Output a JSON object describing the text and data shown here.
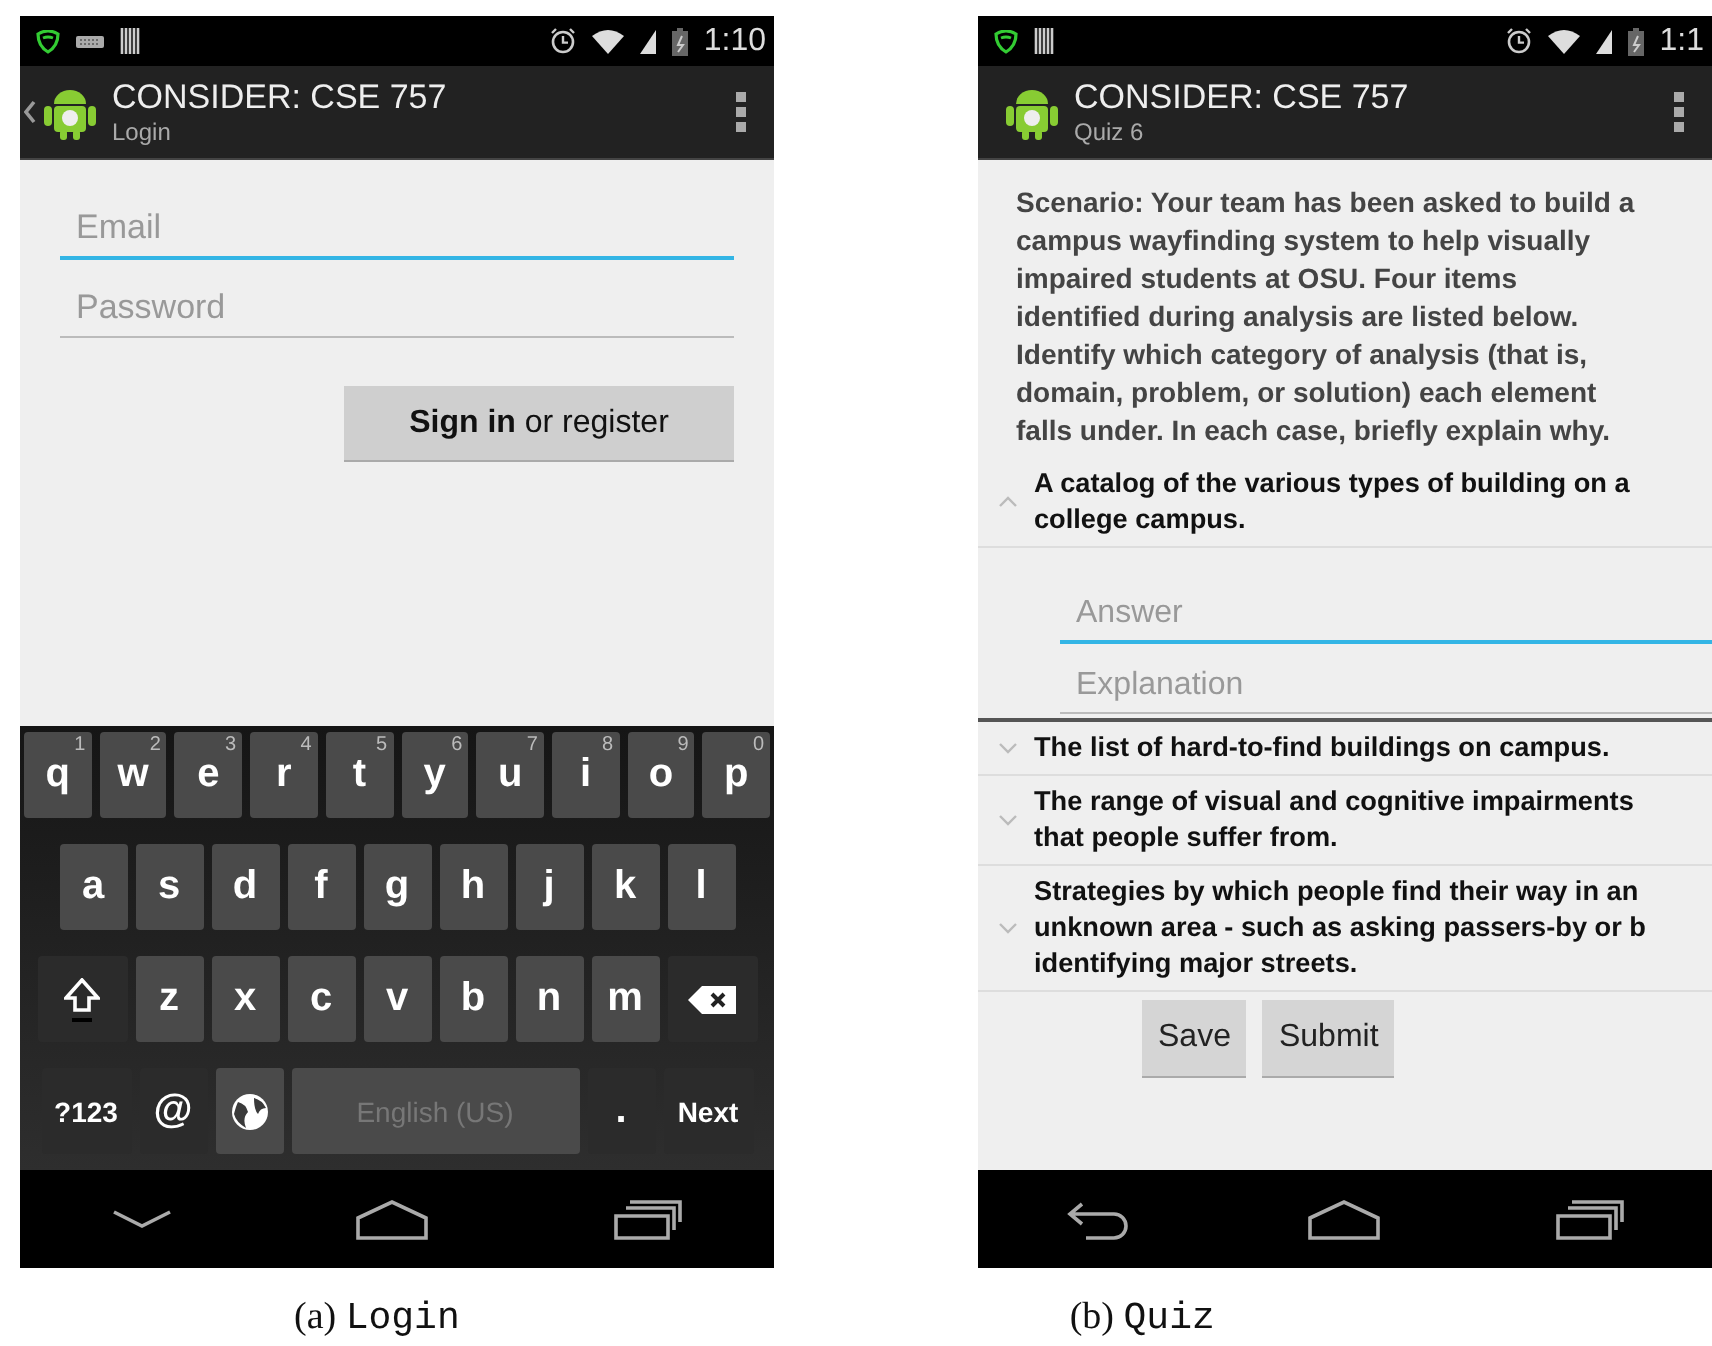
{
  "login": {
    "status_bar": {
      "time": "1:10",
      "keyboard_notice": true
    },
    "action_bar": {
      "title": "CONSIDER: CSE 757",
      "subtitle": "Login",
      "back": true
    },
    "fields": [
      {
        "placeholder": "Email",
        "focused": true
      },
      {
        "placeholder": "Password",
        "focused": false
      }
    ],
    "button": "**Sign in** or register",
    "keyboard": {
      "rows": [
        {
          "keys": [
            {
              "kind": "letter",
              "label": "q",
              "hint": "1"
            },
            {
              "kind": "letter",
              "label": "w",
              "hint": "2"
            },
            {
              "kind": "letter",
              "label": "e",
              "hint": "3"
            },
            {
              "kind": "letter",
              "label": "r",
              "hint": "4"
            },
            {
              "kind": "letter",
              "label": "t",
              "hint": "5"
            },
            {
              "kind": "letter",
              "label": "y",
              "hint": "6"
            },
            {
              "kind": "letter",
              "label": "u",
              "hint": "7"
            },
            {
              "kind": "letter",
              "label": "i",
              "hint": "8"
            },
            {
              "kind": "letter",
              "label": "o",
              "hint": "9"
            },
            {
              "kind": "letter",
              "label": "p",
              "hint": "0"
            }
          ]
        },
        {
          "keys": [
            {
              "kind": "letter",
              "label": "a"
            },
            {
              "kind": "letter",
              "label": "s"
            },
            {
              "kind": "letter",
              "label": "d"
            },
            {
              "kind": "letter",
              "label": "f"
            },
            {
              "kind": "letter",
              "label": "g"
            },
            {
              "kind": "letter",
              "label": "h"
            },
            {
              "kind": "letter",
              "label": "j"
            },
            {
              "kind": "letter",
              "label": "k"
            },
            {
              "kind": "letter",
              "label": "l"
            }
          ]
        },
        {
          "keys": [
            {
              "kind": "shift"
            },
            {
              "kind": "letter",
              "label": "z"
            },
            {
              "kind": "letter",
              "label": "x"
            },
            {
              "kind": "letter",
              "label": "c"
            },
            {
              "kind": "letter",
              "label": "v"
            },
            {
              "kind": "letter",
              "label": "b"
            },
            {
              "kind": "letter",
              "label": "n"
            },
            {
              "kind": "letter",
              "label": "m"
            },
            {
              "kind": "backspace"
            }
          ]
        },
        {
          "keys": [
            {
              "kind": "symbols",
              "label": "?123"
            },
            {
              "kind": "at",
              "label": "@"
            },
            {
              "kind": "globe"
            },
            {
              "kind": "space",
              "label": "English (US)"
            },
            {
              "kind": "period",
              "label": "."
            },
            {
              "kind": "action",
              "label": "Next"
            }
          ]
        }
      ]
    },
    "nav_bar": {
      "keyboard_open": true
    },
    "caption": {
      "label": "(a)",
      "name": "Login"
    }
  },
  "quiz": {
    "status_bar": {
      "time": "1:1",
      "keyboard_notice": false
    },
    "action_bar": {
      "title": "CONSIDER: CSE 757",
      "subtitle": "Quiz 6",
      "back": false
    },
    "scenario": "Scenario: Your team has been asked to build a campus wayfinding system to help visually impaired students at OSU. Four items identified during analysis are listed below. Identify which category of analysis (that is, domain, problem, or solution) each element falls under. In each case, briefly explain why.",
    "items": [
      {
        "lines": [
          "A catalog of the various types of building on a",
          "college campus."
        ],
        "expanded": true,
        "fields": [
          {
            "placeholder": "Answer",
            "focused": true
          },
          {
            "placeholder": "Explanation",
            "focused": false
          }
        ]
      },
      {
        "lines": [
          "The list of hard-to-find buildings on campus."
        ],
        "expanded": false
      },
      {
        "lines": [
          "The range of visual and cognitive impairments",
          "that people suffer from."
        ],
        "expanded": false
      },
      {
        "lines": [
          "Strategies by which people find their way in an",
          "unknown area - such as asking passers-by or b",
          "identifying major streets."
        ],
        "expanded": false
      }
    ],
    "buttons": [
      "Save",
      "Submit"
    ],
    "nav_bar": {
      "keyboard_open": false
    },
    "caption": {
      "label": "(b)",
      "name": "Quiz"
    }
  }
}
